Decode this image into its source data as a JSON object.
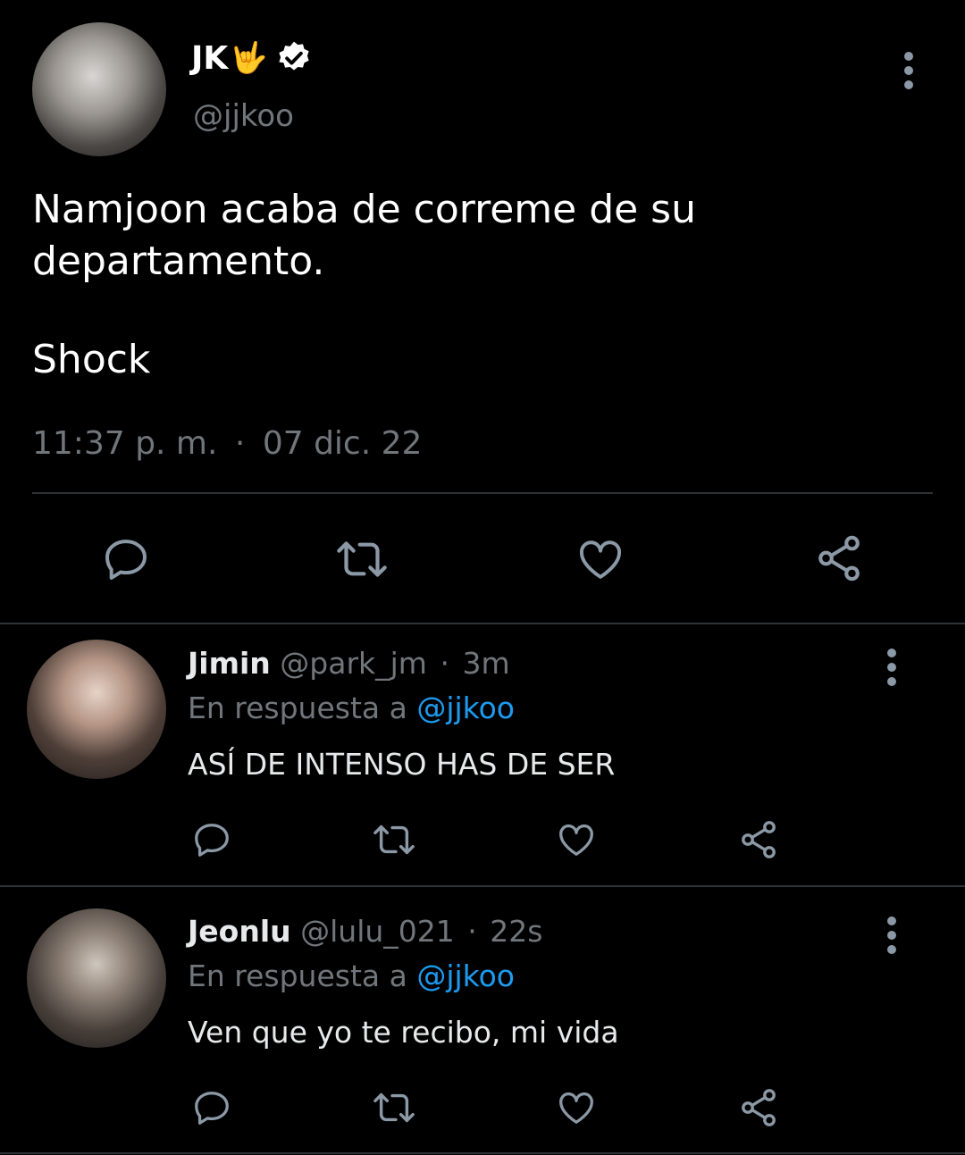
{
  "main_tweet": {
    "display_name": "JK",
    "name_emoji": "🤟",
    "handle": "@jjkoo",
    "text_line1": "Namjoon acaba de correme de su",
    "text_line2": "departamento.",
    "text_line3": "Shock",
    "time": "11:37 p. m.",
    "dot": "·",
    "date": "07 dic. 22"
  },
  "replies": [
    {
      "display_name": "Jimin",
      "handle": "@park_jm",
      "dot": "·",
      "age": "3m",
      "reply_prefix": "En respuesta a",
      "reply_to": "@jjkoo",
      "text": "ASÍ DE INTENSO HAS DE SER"
    },
    {
      "display_name": "Jeonlu",
      "handle": "@lulu_021",
      "dot": "·",
      "age": "22s",
      "reply_prefix": "En respuesta a",
      "reply_to": "@jjkoo",
      "text": "Ven que yo te recibo, mi vida"
    }
  ],
  "colors": {
    "background": "#000000",
    "text": "#e7e9ea",
    "muted": "#71767b",
    "link": "#1d9bf0",
    "divider": "#2f3336"
  },
  "icons": [
    "verified-badge-icon",
    "more-icon",
    "reply-icon",
    "retweet-icon",
    "like-icon",
    "share-icon"
  ]
}
